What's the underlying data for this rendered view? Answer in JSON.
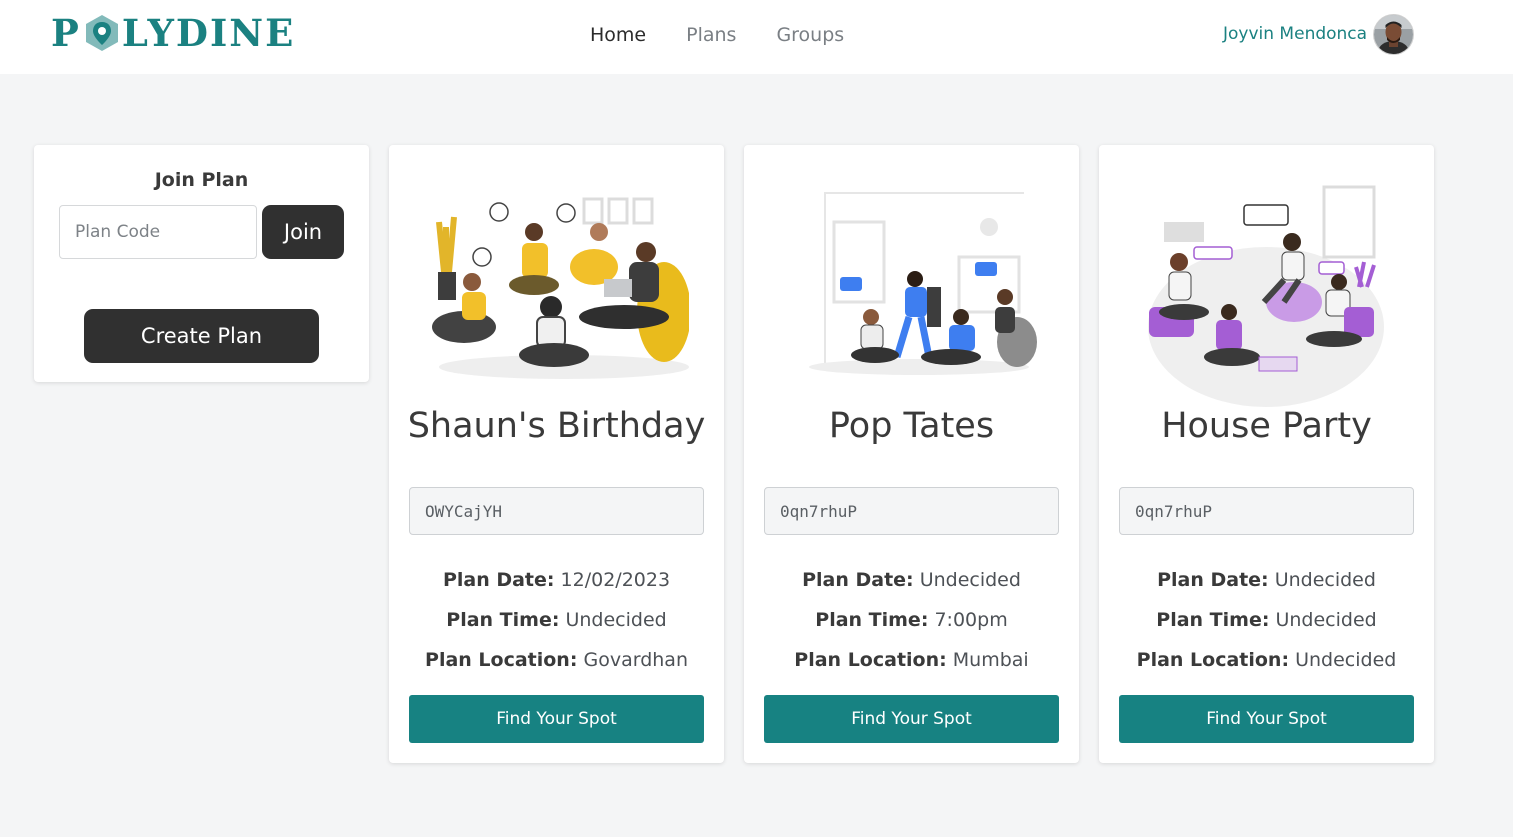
{
  "brand": {
    "name_left": "P",
    "name_right": "LYDINE",
    "color": "#1b8181"
  },
  "nav": {
    "items": [
      "Home",
      "Plans",
      "Groups"
    ],
    "active": "Home"
  },
  "user": {
    "name": "Joyvin Mendonca"
  },
  "join": {
    "title": "Join Plan",
    "placeholder": "Plan Code",
    "join_label": "Join",
    "create_label": "Create Plan"
  },
  "labels": {
    "date": "Plan Date:",
    "time": "Plan Time:",
    "location": "Plan Location:"
  },
  "plans": [
    {
      "title": "Shaun's Birthday",
      "code": "OWYCajYH",
      "date": "12/02/2023",
      "time": "Undecided",
      "location": "Govardhan",
      "button": "Find Your Spot",
      "accent": "#f2c02a"
    },
    {
      "title": "Pop Tates",
      "code": "0qn7rhuP",
      "date": "Undecided",
      "time": "7:00pm",
      "location": "Mumbai",
      "button": "Find Your Spot",
      "accent": "#3e7ef0"
    },
    {
      "title": "House Party",
      "code": "0qn7rhuP",
      "date": "Undecided",
      "time": "Undecided",
      "location": "Undecided",
      "button": "Find Your Spot",
      "accent": "#a45ed4"
    }
  ],
  "colors": {
    "teal": "#178282",
    "dark_button": "#303030",
    "background": "#f4f5f6"
  }
}
